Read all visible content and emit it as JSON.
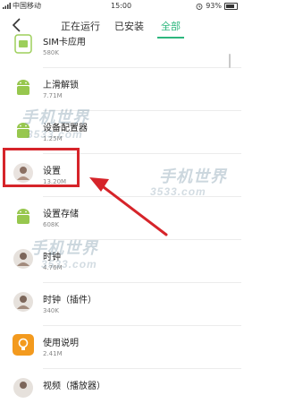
{
  "status_bar": {
    "carrier": "中国移动",
    "time": "15:00",
    "battery": "93%"
  },
  "tabs": [
    {
      "label": "正在运行",
      "active": false
    },
    {
      "label": "已安装",
      "active": false
    },
    {
      "label": "全部",
      "active": true
    }
  ],
  "accent_color": "#2db77e",
  "highlight_color": "#d6242a",
  "apps": [
    {
      "name": "SIM卡应用",
      "size": "580K",
      "icon": "sim-card-icon"
    },
    {
      "name": "上滑解锁",
      "size": "7.71M",
      "icon": "android-icon"
    },
    {
      "name": "设备配置器",
      "size": "1.25M",
      "icon": "android-icon"
    },
    {
      "name": "设置",
      "size": "13.20M",
      "icon": "settings-avatar-icon"
    },
    {
      "name": "设置存储",
      "size": "608K",
      "icon": "android-icon"
    },
    {
      "name": "时钟",
      "size": "4.76M",
      "icon": "clock-avatar-icon"
    },
    {
      "name": "时钟（插件）",
      "size": "340K",
      "icon": "clock-avatar-icon"
    },
    {
      "name": "使用说明",
      "size": "2.41M",
      "icon": "lightbulb-icon"
    },
    {
      "name": "视频（播放器）",
      "size": "",
      "icon": "video-avatar-icon"
    }
  ],
  "watermark": {
    "brand": "手机世界",
    "number": "3533.com"
  }
}
